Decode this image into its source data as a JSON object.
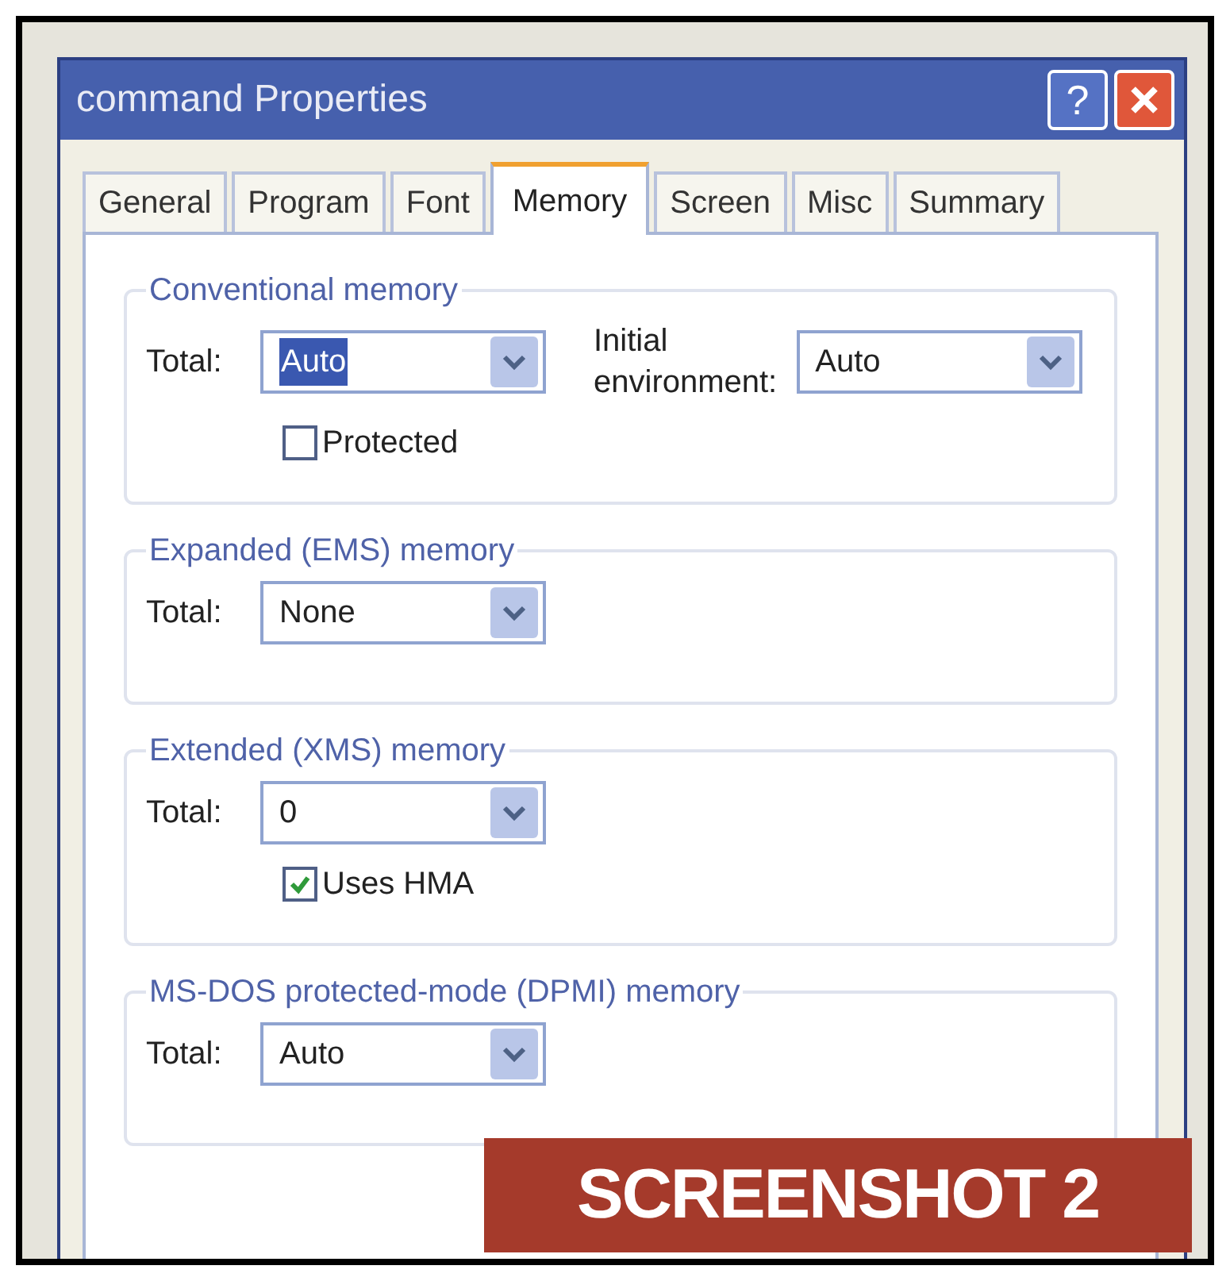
{
  "window": {
    "title": "command Properties",
    "help_label": "?"
  },
  "tabs": [
    {
      "label": "General",
      "selected": false
    },
    {
      "label": "Program",
      "selected": false
    },
    {
      "label": "Font",
      "selected": false
    },
    {
      "label": "Memory",
      "selected": true
    },
    {
      "label": "Screen",
      "selected": false
    },
    {
      "label": "Misc",
      "selected": false
    },
    {
      "label": "Summary",
      "selected": false
    }
  ],
  "groups": [
    {
      "title": "Conventional memory",
      "field": {
        "label": "Total:",
        "value": "Auto",
        "text_selected": true
      },
      "side_field": {
        "label_lines": [
          "Initial",
          "environment:"
        ],
        "value": "Auto"
      },
      "checkbox": {
        "label": "Protected",
        "checked": false
      }
    },
    {
      "title": "Expanded (EMS) memory",
      "field": {
        "label": "Total:",
        "value": "None",
        "text_selected": false
      }
    },
    {
      "title": "Extended (XMS) memory",
      "field": {
        "label": "Total:",
        "value": "0",
        "text_selected": false
      },
      "checkbox": {
        "label": "Uses HMA",
        "checked": true
      }
    },
    {
      "title": "MS-DOS protected-mode (DPMI) memory",
      "field": {
        "label": "Total:",
        "value": "Auto",
        "text_selected": false
      }
    }
  ],
  "caption_label": "SCREENSHOT 2"
}
